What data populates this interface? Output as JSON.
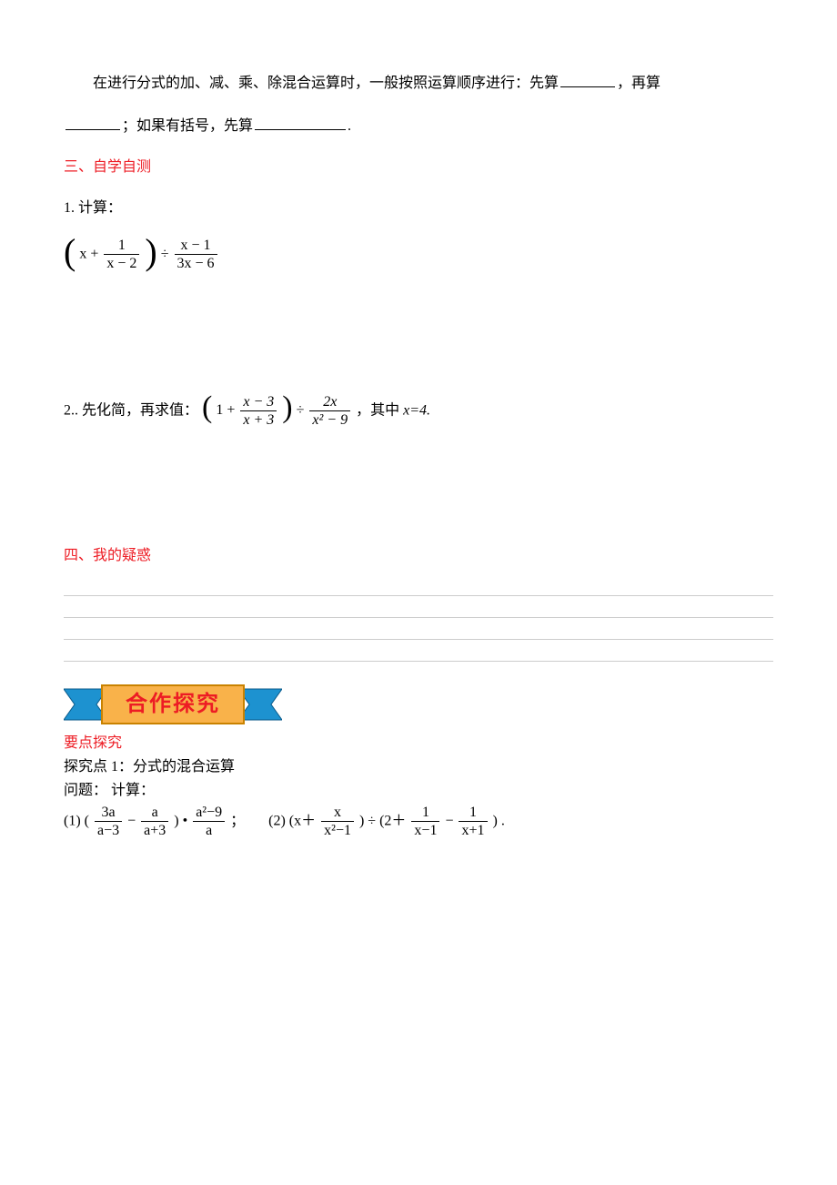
{
  "intro": {
    "line1_a": "在进行分式的加、减、乘、除混合运算时，一般按照运算顺序进行：先算",
    "line1_b": "，再算",
    "line2_a": "；如果有括号，先算",
    "line2_b": "."
  },
  "section3_title": "三、自学自测",
  "q1": {
    "label": "1. 计算：",
    "expr_plain": "(x + 1/(x−2)) ÷ (x−1)/(3x−6)",
    "x": "x",
    "plus": "+",
    "frac1_num": "1",
    "frac1_den": "x − 2",
    "div": "÷",
    "frac2_num": "x − 1",
    "frac2_den": "3x − 6"
  },
  "q2": {
    "label_a": "2.. 先化简，再求值：",
    "label_b": "，其中",
    "xval": "x=4.",
    "expr_plain": "(1 + (x−3)/(x+3)) ÷ 2x/(x²−9)",
    "one": "1",
    "plus": "+",
    "frac1_num": "x − 3",
    "frac1_den": "x + 3",
    "div": "÷",
    "frac2_num": "2x",
    "frac2_den": "x² − 9"
  },
  "section4_title": "四、我的疑惑",
  "banner_text": "合作探究",
  "key_points_title": "要点探究",
  "topic1_title": "探究点 1：分式的混合运算",
  "problem_label": "问题：  计算：",
  "p1": {
    "label": "(1) (",
    "f1_num": "3a",
    "f1_den": "a−3",
    "minus": "−",
    "f2_num": "a",
    "f2_den": "a+3",
    "close_dot": ")   •",
    "f3_num": "a²−9",
    "f3_den": "a",
    "semi": "；"
  },
  "p2": {
    "label": "(2) (x＋",
    "f1_num": "x",
    "f1_den": "x²−1",
    "mid": ") ÷ (2＋",
    "f2_num": "1",
    "f2_den": "x−1",
    "minus": "−",
    "f3_num": "1",
    "f3_den": "x+1",
    "end": ") ."
  }
}
